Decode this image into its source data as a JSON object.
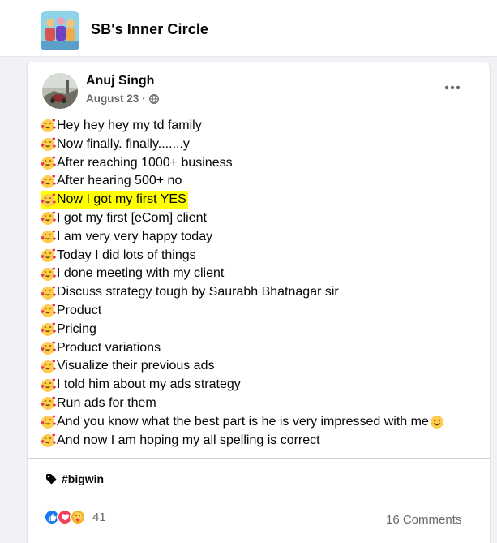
{
  "group": {
    "name": "SB's Inner Circle",
    "avatar_icon": "group-photo-icon"
  },
  "post": {
    "author": "Anuj Singh",
    "date": "August 23",
    "meta_separator": "·",
    "privacy_icon": "globe-icon",
    "more_icon": "more-options-icon",
    "line_emoji_icon": "smiling-face-with-hearts-icon",
    "highlight_color": "#ffff00",
    "lines": [
      {
        "text": "Hey hey hey my td family"
      },
      {
        "text": "Now finally.   finally.......y"
      },
      {
        "text": "After reaching 1000+ business"
      },
      {
        "text": "After hearing 500+ no"
      },
      {
        "text": "Now I got my first YES",
        "highlight": true
      },
      {
        "text": "I got my first [eCom] client"
      },
      {
        "text": "I am very very happy today"
      },
      {
        "text": "Today I did lots of things"
      },
      {
        "text": "I done meeting with my client"
      },
      {
        "text": "Discuss strategy tough by Saurabh Bhatnagar sir"
      },
      {
        "text": "Product"
      },
      {
        "text": "Pricing"
      },
      {
        "text": "Product variations"
      },
      {
        "text": "Visualize their previous ads"
      },
      {
        "text": "I told him about my ads strategy"
      },
      {
        "text": "Run ads for them"
      },
      {
        "text": "And you know what the best part is he is very impressed with me",
        "trailing_emoji": "smiling-face-icon"
      },
      {
        "text": "And now I am hoping my all spelling is correct"
      }
    ],
    "hashtag": "#bigwin",
    "reactions": {
      "icons": [
        "like-icon",
        "love-icon",
        "care-icon"
      ],
      "count": "41"
    },
    "comments": "16 Comments"
  },
  "colors": {
    "page_bg": "#f0f2f5",
    "card_bg": "#ffffff",
    "like_blue": "#1877f2",
    "love_red": "#f33e58",
    "secondary_text": "#65676b"
  }
}
